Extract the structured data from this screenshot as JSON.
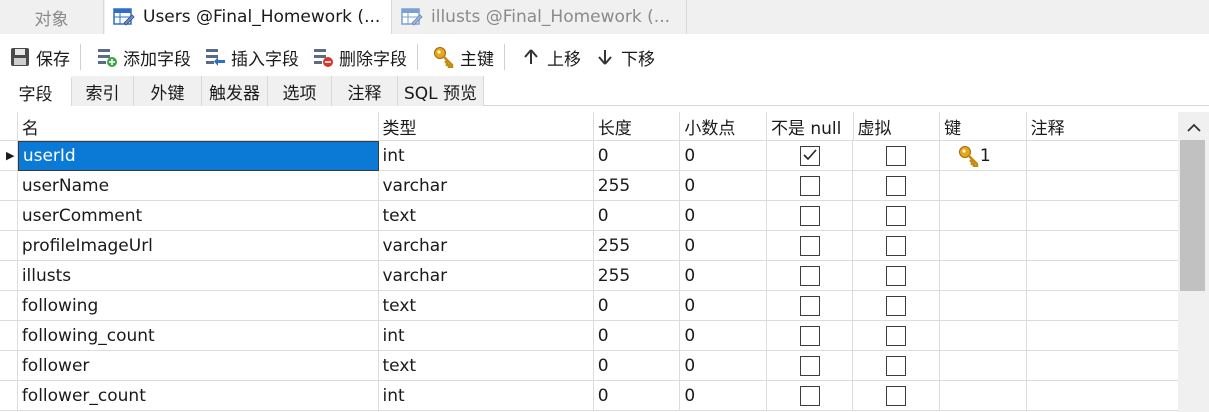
{
  "tabs": {
    "objects": "对象",
    "users": "Users @Final_Homework (...",
    "illusts": "illusts @Final_Homework (..."
  },
  "toolbar": {
    "save": "保存",
    "add_field": "添加字段",
    "insert_field": "插入字段",
    "delete_field": "删除字段",
    "primary_key": "主键",
    "move_up": "上移",
    "move_down": "下移"
  },
  "subtabs": [
    "字段",
    "索引",
    "外键",
    "触发器",
    "选项",
    "注释",
    "SQL 预览"
  ],
  "columns": [
    "名",
    "类型",
    "长度",
    "小数点",
    "不是 null",
    "虚拟",
    "键",
    "注释"
  ],
  "rows": [
    {
      "name": "userId",
      "type": "int",
      "length": "0",
      "decimals": "0",
      "not_null": true,
      "virtual": false,
      "key": "1",
      "comment": ""
    },
    {
      "name": "userName",
      "type": "varchar",
      "length": "255",
      "decimals": "0",
      "not_null": false,
      "virtual": false,
      "key": "",
      "comment": ""
    },
    {
      "name": "userComment",
      "type": "text",
      "length": "0",
      "decimals": "0",
      "not_null": false,
      "virtual": false,
      "key": "",
      "comment": ""
    },
    {
      "name": "profileImageUrl",
      "type": "varchar",
      "length": "255",
      "decimals": "0",
      "not_null": false,
      "virtual": false,
      "key": "",
      "comment": ""
    },
    {
      "name": "illusts",
      "type": "varchar",
      "length": "255",
      "decimals": "0",
      "not_null": false,
      "virtual": false,
      "key": "",
      "comment": ""
    },
    {
      "name": "following",
      "type": "text",
      "length": "0",
      "decimals": "0",
      "not_null": false,
      "virtual": false,
      "key": "",
      "comment": ""
    },
    {
      "name": "following_count",
      "type": "int",
      "length": "0",
      "decimals": "0",
      "not_null": false,
      "virtual": false,
      "key": "",
      "comment": ""
    },
    {
      "name": "follower",
      "type": "text",
      "length": "0",
      "decimals": "0",
      "not_null": false,
      "virtual": false,
      "key": "",
      "comment": ""
    },
    {
      "name": "follower_count",
      "type": "int",
      "length": "0",
      "decimals": "0",
      "not_null": false,
      "virtual": false,
      "key": "",
      "comment": ""
    }
  ],
  "icons": {
    "table_tab": "table-icon",
    "save": "save-icon",
    "add": "add-field-icon",
    "insert": "insert-field-icon",
    "delete": "delete-field-icon",
    "key": "key-icon",
    "up": "arrow-up-icon",
    "down": "arrow-down-icon"
  },
  "colors": {
    "selection": "#0b79d6",
    "key_gold": "#e8a81c",
    "add_green": "#3aa545",
    "delete_red": "#d9362b",
    "insert_blue": "#2f6fc4"
  }
}
